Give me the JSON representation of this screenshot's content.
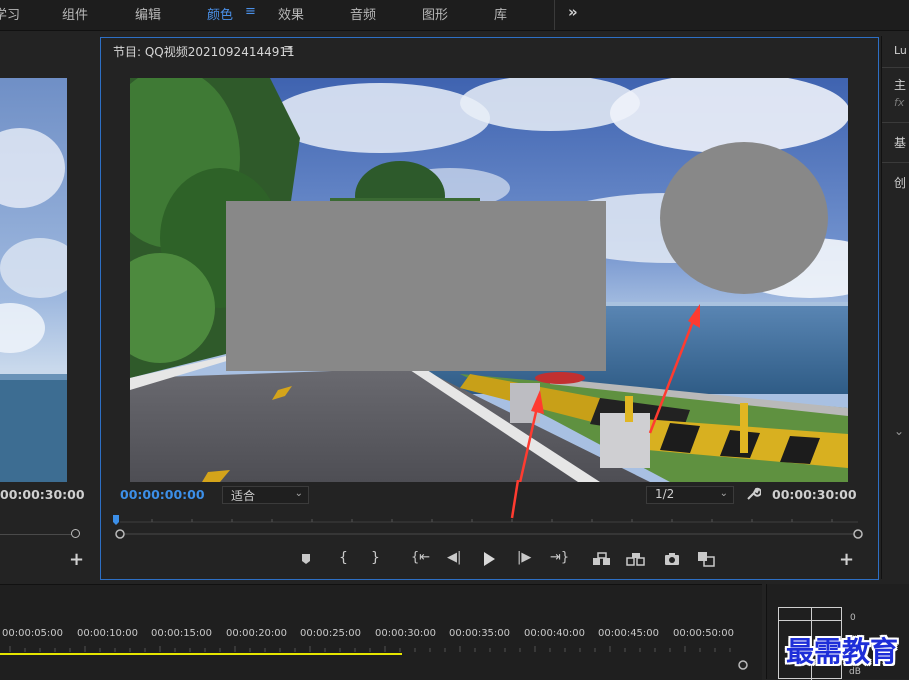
{
  "workspace_tabs": {
    "learn": "学习",
    "assembly": "组件",
    "editing": "编辑",
    "color": "颜色",
    "effects": "效果",
    "audio": "音频",
    "graphics": "图形",
    "libraries": "库",
    "more": "»",
    "menu_icon": "≡"
  },
  "source_monitor": {
    "duration": "00:00:30:00",
    "add_button": "+"
  },
  "program_monitor": {
    "title": "节目: QQ视频20210924144911",
    "title_menu": "≡",
    "current_time": "00:00:00:00",
    "fit_value": "适合",
    "resolution_value": "1/2",
    "duration": "00:00:30:00",
    "add_button": "+",
    "overlay_shapes": [
      "rectangle",
      "ellipse"
    ],
    "overlay_color": "#888888",
    "annotation_color": "#ff3b30"
  },
  "right_panel": {
    "title": "Lu",
    "item_main": "主",
    "fx_label": "fx",
    "item_basic": "基",
    "item_create": "创",
    "chevron": "⌄"
  },
  "timeline": {
    "timecodes": [
      "00:00:05:00",
      "00:00:10:00",
      "00:00:15:00",
      "00:00:20:00",
      "00:00:25:00",
      "00:00:30:00",
      "00:00:35:00",
      "00:00:40:00",
      "00:00:45:00",
      "00:00:50:00"
    ],
    "work_area_color": "#e6e600"
  },
  "audio_meter": {
    "top_label": "0",
    "bottom_label": "dB"
  },
  "watermark": "最需教育",
  "colors": {
    "accent": "#2d6fc4",
    "timecode_blue": "#3c8fe8",
    "background": "#232323"
  }
}
